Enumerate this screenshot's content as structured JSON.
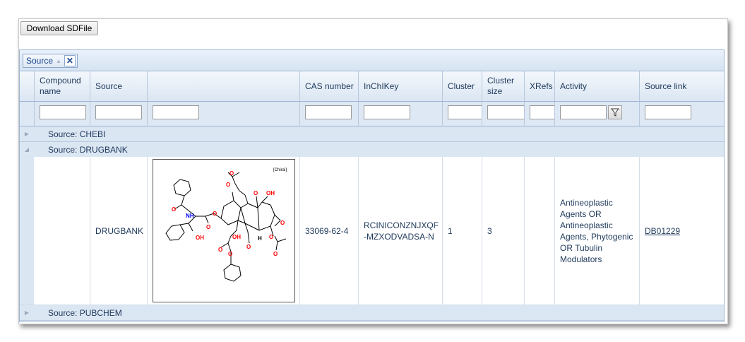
{
  "toolbar": {
    "download_label": "Download SDFile"
  },
  "group_panel": {
    "chip_label": "Source"
  },
  "columns": {
    "compound_name": "Compound name",
    "source": "Source",
    "structure": "",
    "cas_number": "CAS number",
    "inchikey": "InChIKey",
    "cluster": "Cluster",
    "cluster_size": "Cluster size",
    "xrefs": "XRefs",
    "activity": "Activity",
    "source_link": "Source link"
  },
  "groups": [
    {
      "label": "Source: CHEBI",
      "expanded": false
    },
    {
      "label": "Source: DRUGBANK",
      "expanded": true
    },
    {
      "label": "Source: PUBCHEM",
      "expanded": false
    }
  ],
  "row": {
    "compound_name": "",
    "source": "DRUGBANK",
    "structure_label": "[Chiral]",
    "cas_number": "33069-62-4",
    "inchikey": "RCINICONZNJXQF-MZXODVADSA-N",
    "cluster": "1",
    "cluster_size": "3",
    "xrefs": "",
    "activity": "Antineoplastic Agents OR Antineoplastic Agents, Phytogenic OR Tubulin Modulators",
    "source_link": "DB01229"
  },
  "structure_atoms": {
    "nh": "NH",
    "oh": "OH",
    "o": "O",
    "h": "H"
  },
  "colors": {
    "oxygen": "#ff0000",
    "nitrogen": "#0000ff",
    "header_bg": "#dbe6f3",
    "text": "#1e395b"
  }
}
